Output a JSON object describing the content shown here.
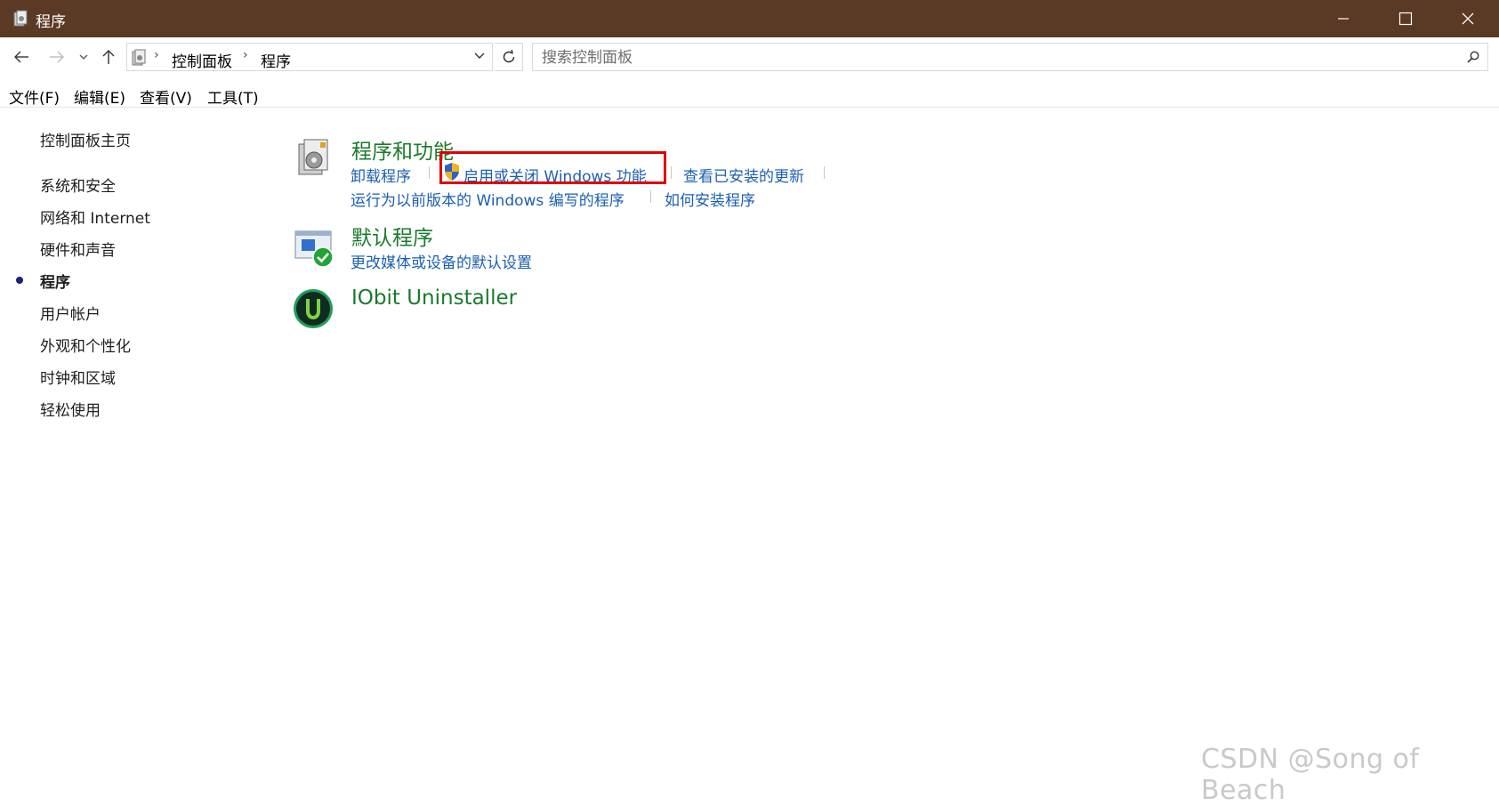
{
  "window": {
    "title": "程序"
  },
  "address": {
    "crumbs": [
      "控制面板",
      "程序"
    ]
  },
  "search": {
    "placeholder": "搜索控制面板"
  },
  "menu": [
    "文件(F)",
    "编辑(E)",
    "查看(V)",
    "工具(T)"
  ],
  "sidebar": {
    "home": "控制面板主页",
    "items": [
      "系统和安全",
      "网络和 Internet",
      "硬件和声音",
      "程序",
      "用户帐户",
      "外观和个性化",
      "时钟和区域",
      "轻松使用"
    ],
    "current": "程序"
  },
  "categories": [
    {
      "title": "程序和功能",
      "links": [
        "卸载程序",
        "启用或关闭 Windows 功能",
        "查看已安装的更新",
        "运行为以前版本的 Windows 编写的程序",
        "如何安装程序"
      ]
    },
    {
      "title": "默认程序",
      "links": [
        "更改媒体或设备的默认设置"
      ]
    },
    {
      "title": "IObit Uninstaller",
      "links": []
    }
  ],
  "watermark": "CSDN @Song of Beach",
  "colors": {
    "titlebar": "#5a3a24",
    "link": "#1a5fb4",
    "category": "#1a7a2c",
    "highlight": "#e00000"
  }
}
